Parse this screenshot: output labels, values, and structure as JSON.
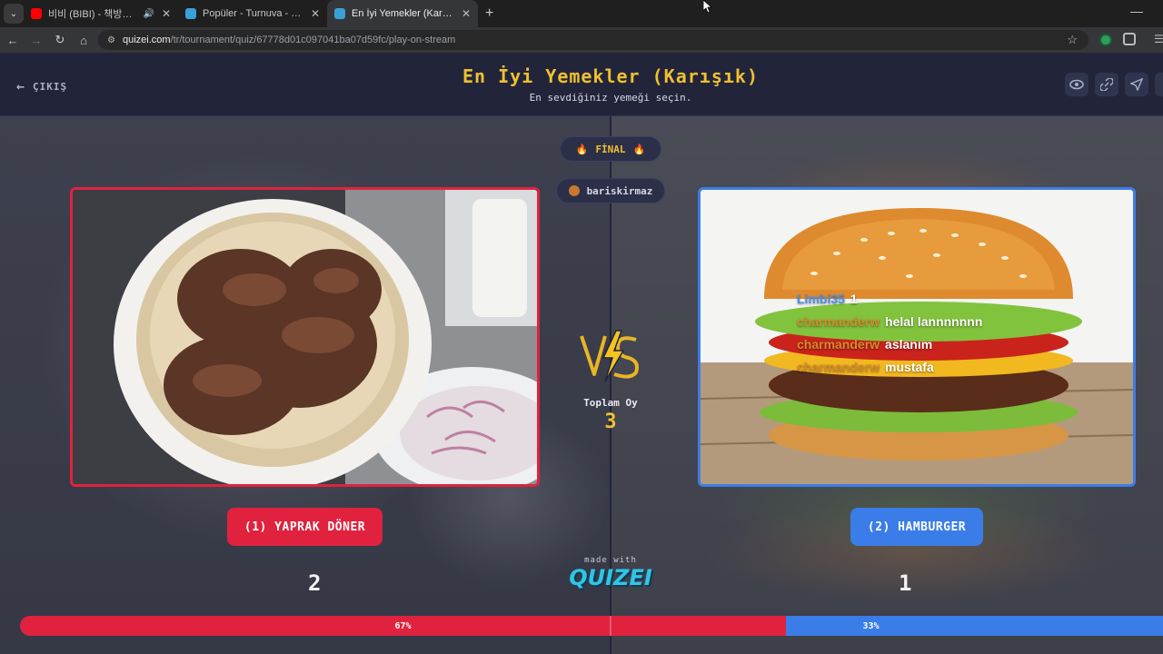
{
  "browser": {
    "tabs": [
      {
        "title": "비비 (BIBI) - 책방오빠 문학",
        "favicon_color": "#ff0000",
        "has_audio": true,
        "active": false
      },
      {
        "title": "Popüler - Turnuva - Quizei",
        "favicon_color": "#f0c030",
        "has_audio": false,
        "active": false
      },
      {
        "title": "En İyi Yemekler (Karışık) - Quizei",
        "favicon_color": "#f0c030",
        "has_audio": false,
        "active": true
      }
    ],
    "url_host": "quizei.com",
    "url_path": "/tr/tournament/quiz/67778d01c097041ba07d59fc/play-on-stream"
  },
  "header": {
    "exit_label": "ÇIKIŞ",
    "title": "En İyi Yemekler (Karışık)",
    "subtitle": "En sevdiğiniz yemeği seçin.",
    "actions": [
      "eye-icon",
      "share-icon",
      "send-icon"
    ]
  },
  "round": {
    "stage_label": "FİNAL",
    "streamer": "bariskirmaz"
  },
  "total": {
    "label": "Toplam Oy",
    "count": "3"
  },
  "left": {
    "label": "(1) YAPRAK DÖNER",
    "votes": "2",
    "percent_label": "67%",
    "share": 0.67,
    "color": "#e0223e"
  },
  "right": {
    "label": "(2) HAMBURGER",
    "votes": "1",
    "percent_label": "33%",
    "share": 0.33,
    "color": "#3a7de8"
  },
  "chat": [
    {
      "user": "Limbi35",
      "message": "1",
      "user_color": "#4a90e2"
    },
    {
      "user": "charmanderw",
      "message": "helal lannnnnnn",
      "user_color": "#d58a2e"
    },
    {
      "user": "charmanderw",
      "message": "aslanım",
      "user_color": "#d58a2e"
    },
    {
      "user": "charmanderw",
      "message": "mustafa",
      "user_color": "#d58a2e"
    }
  ],
  "footer": {
    "made_with": "made with",
    "logo_text": "QUIZEI"
  }
}
